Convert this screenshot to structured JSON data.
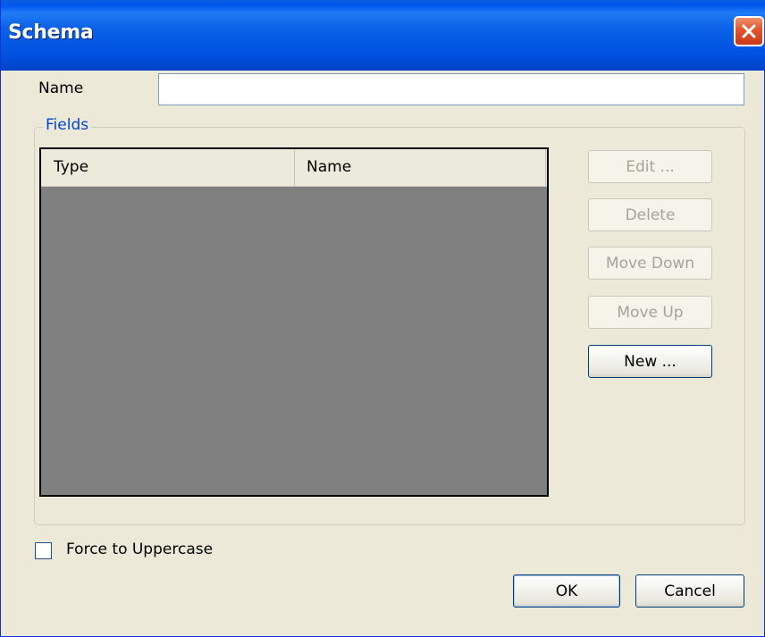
{
  "window": {
    "title": "Schema"
  },
  "form": {
    "name_label": "Name",
    "name_value": "",
    "fields_group_label": "Fields"
  },
  "list": {
    "columns": [
      "Type",
      "Name"
    ],
    "rows": []
  },
  "side_buttons": {
    "edit": "Edit ...",
    "delete": "Delete",
    "move_down": "Move Down",
    "move_up": "Move Up",
    "new": "New ..."
  },
  "options": {
    "force_uppercase_label": "Force to Uppercase",
    "force_uppercase_checked": false
  },
  "footer": {
    "ok": "OK",
    "cancel": "Cancel"
  },
  "colors": {
    "titlebar": "#0058ee",
    "dialog_bg": "#ece9d8",
    "list_bg": "#808080",
    "group_label": "#0046d5",
    "close_button": "#e2542b"
  },
  "icons": {
    "close": "close-icon"
  }
}
